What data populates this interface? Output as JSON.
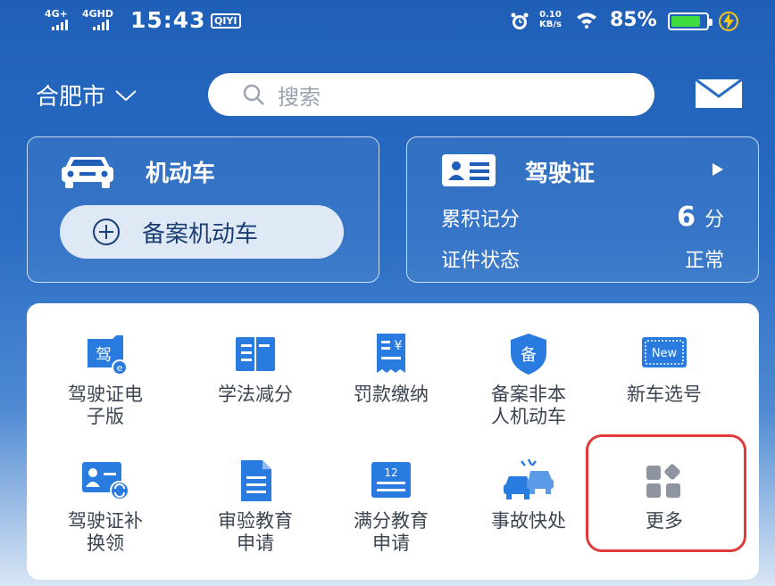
{
  "status_bar": {
    "signal1": "4G+",
    "signal2": "4GHD",
    "time": "15:43",
    "app_badge": "QIYI",
    "speed_value": "0.10",
    "speed_unit": "KB/s",
    "battery_percent": "85%",
    "battery_level": 0.85
  },
  "header": {
    "city": "合肥市",
    "search_placeholder": "搜索"
  },
  "vehicle_card": {
    "title": "机动车",
    "register_button": "备案机动车"
  },
  "license_card": {
    "title": "驾驶证",
    "points_label": "累积记分",
    "points_value": "6",
    "points_unit": "分",
    "status_label": "证件状态",
    "status_value": "正常"
  },
  "services": {
    "row1": [
      {
        "label": "驾驶证电\n子版",
        "icon": "e-license-icon"
      },
      {
        "label": "学法减分",
        "icon": "book-icon"
      },
      {
        "label": "罚款缴纳",
        "icon": "receipt-icon"
      },
      {
        "label": "备案非本\n人机动车",
        "icon": "shield-icon"
      },
      {
        "label": "新车选号",
        "icon": "new-plate-icon"
      }
    ],
    "row2": [
      {
        "label": "驾驶证补\n换领",
        "icon": "license-renew-icon"
      },
      {
        "label": "审验教育\n申请",
        "icon": "document-icon"
      },
      {
        "label": "满分教育\n申请",
        "icon": "calendar-icon"
      },
      {
        "label": "事故快处",
        "icon": "accident-icon"
      },
      {
        "label": "更多",
        "icon": "more-apps-icon"
      }
    ]
  },
  "icon_texts": {
    "e_license_char": "驾",
    "shield_char": "备",
    "new_badge": "New",
    "calendar_num": "12"
  },
  "colors": {
    "accent": "#2a7be0",
    "highlight": "#e03a3a"
  }
}
